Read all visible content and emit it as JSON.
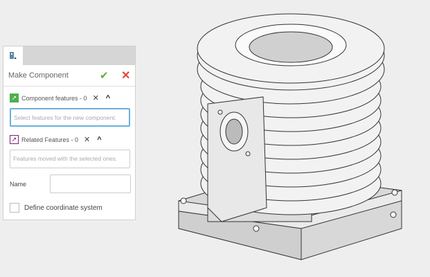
{
  "panel": {
    "tab_icon": "make-component-icon",
    "title": "Make Component",
    "ok_icon": "checkmark-icon",
    "cancel_icon": "close-icon",
    "component_features": {
      "label": "Component features - 0",
      "placeholder": "Select features for the new component.",
      "color": "#4caf50"
    },
    "related_features": {
      "label": "Related Features - 0",
      "placeholder": "Features moved with the selected ones.",
      "color": "#7b1f7b"
    },
    "name_label": "Name",
    "name_value": "",
    "define_cs_label": "Define coordinate system",
    "define_cs_checked": false
  },
  "viewport": {
    "model": "engine-cylinder-with-fins"
  }
}
